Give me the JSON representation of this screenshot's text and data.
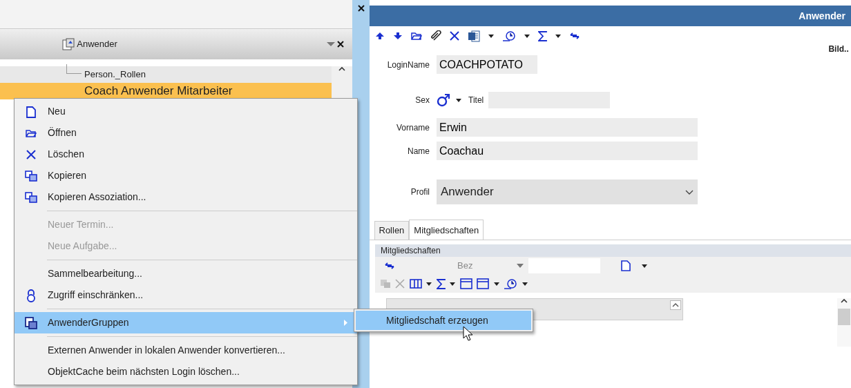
{
  "left_panel": {
    "title": "Anwender",
    "tree": [
      {
        "label": "Person._Rollen",
        "selected": false
      },
      {
        "label": "Coach Anwender Mitarbeiter",
        "selected": true
      }
    ]
  },
  "context_menu": {
    "items": [
      {
        "kind": "item",
        "label": "Neu",
        "disabled": false,
        "selected": false,
        "submenu": false
      },
      {
        "kind": "item",
        "label": "Öffnen",
        "disabled": false,
        "selected": false,
        "submenu": false
      },
      {
        "kind": "item",
        "label": "Löschen",
        "disabled": false,
        "selected": false,
        "submenu": false
      },
      {
        "kind": "item",
        "label": "Kopieren",
        "disabled": false,
        "selected": false,
        "submenu": false
      },
      {
        "kind": "item",
        "label": "Kopieren Assoziation...",
        "disabled": false,
        "selected": false,
        "submenu": false
      },
      {
        "kind": "separator"
      },
      {
        "kind": "item",
        "label": "Neuer Termin...",
        "disabled": true,
        "selected": false,
        "submenu": false
      },
      {
        "kind": "item",
        "label": "Neue Aufgabe...",
        "disabled": true,
        "selected": false,
        "submenu": false
      },
      {
        "kind": "separator"
      },
      {
        "kind": "item",
        "label": "Sammelbearbeitung...",
        "disabled": false,
        "selected": false,
        "submenu": false
      },
      {
        "kind": "item",
        "label": "Zugriff einschränken...",
        "disabled": false,
        "selected": false,
        "submenu": false
      },
      {
        "kind": "separator"
      },
      {
        "kind": "item",
        "label": "AnwenderGruppen",
        "disabled": false,
        "selected": true,
        "submenu": true
      },
      {
        "kind": "separator"
      },
      {
        "kind": "item",
        "label": "Externen Anwender in lokalen Anwender konvertieren...",
        "disabled": false,
        "selected": false,
        "submenu": false
      },
      {
        "kind": "item",
        "label": "ObjektCache beim nächsten Login löschen...",
        "disabled": false,
        "selected": false,
        "submenu": false
      }
    ]
  },
  "submenu": {
    "items": [
      {
        "label": "Mitgliedschaft erzeugen",
        "selected": true
      }
    ]
  },
  "document": {
    "title": "Anwender",
    "picture_label": "Bild..",
    "login_name": {
      "label": "LoginName",
      "value": "COACHPOTATO"
    },
    "sex": {
      "label": "Sex"
    },
    "titel": {
      "label": "Titel"
    },
    "vorname": {
      "label": "Vorname",
      "value": "Erwin"
    },
    "name": {
      "label": "Name",
      "value": "Coachau"
    },
    "profil": {
      "label": "Profil",
      "value": "Anwender"
    },
    "tabs": [
      {
        "label": "Rollen",
        "selected": false
      },
      {
        "label": "Mitgliedschaften",
        "selected": true
      }
    ],
    "memberships": {
      "title": "Mitgliedschaften",
      "filter_label": "Bez"
    }
  }
}
